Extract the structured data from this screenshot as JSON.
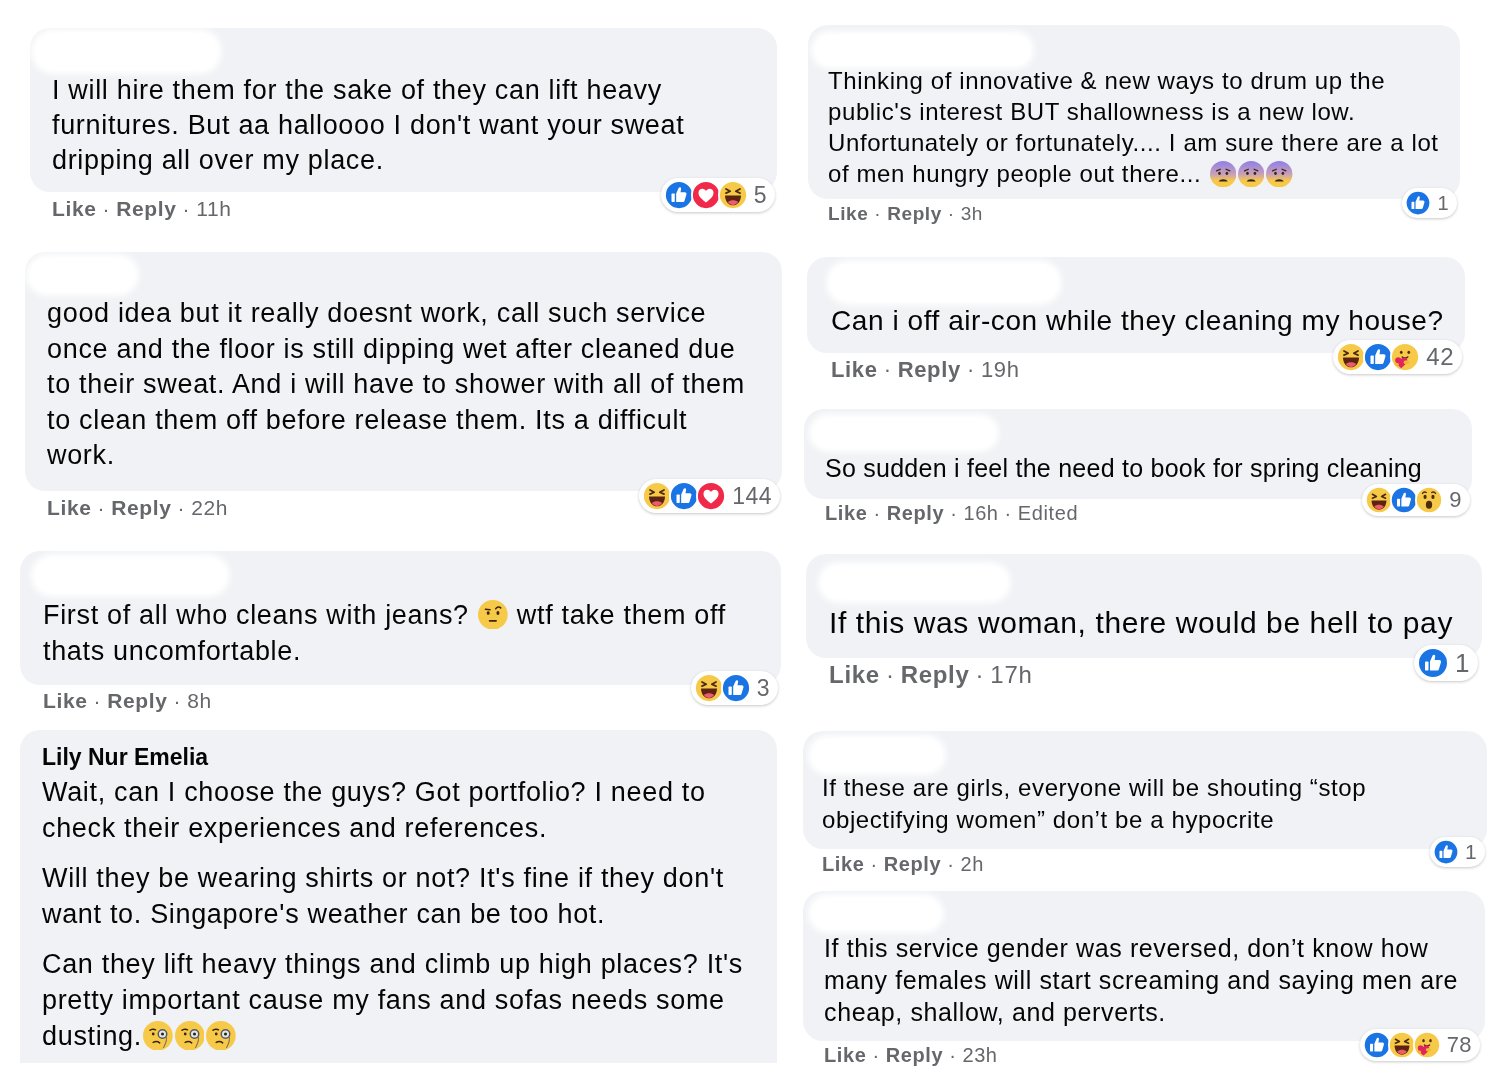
{
  "columns": [
    {
      "comments": [
        {
          "author_hidden": true,
          "body": [
            {
              "rows": [
                [
                  {
                    "kind": "text",
                    "text": "I will hire them for the sake of they can lift heavy furnitures. But aa halloooo I don't want your sweat dripping all over my place."
                  }
                ]
              ]
            }
          ],
          "meta": [
            {
              "kind": "action",
              "text": "Like"
            },
            {
              "kind": "separator",
              "text": "·"
            },
            {
              "kind": "action",
              "text": "Reply"
            },
            {
              "kind": "separator",
              "text": "·"
            },
            {
              "kind": "time",
              "text": "11h"
            }
          ],
          "reactions": {
            "icons": [
              {
                "kind": "like"
              },
              {
                "kind": "love"
              },
              {
                "kind": "haha"
              }
            ],
            "count": "5"
          }
        },
        {
          "author_hidden": true,
          "body": [
            {
              "rows": [
                [
                  {
                    "kind": "text",
                    "text": "good idea but it really doesnt work, call such service once and the floor is still dipping wet after cleaned due to their sweat. And i will have to shower with all of them to clean them off before release them. Its a difficult work."
                  }
                ]
              ]
            }
          ],
          "meta": [
            {
              "kind": "action",
              "text": "Like"
            },
            {
              "kind": "separator",
              "text": "·"
            },
            {
              "kind": "action",
              "text": "Reply"
            },
            {
              "kind": "separator",
              "text": "·"
            },
            {
              "kind": "time",
              "text": "22h"
            }
          ],
          "reactions": {
            "icons": [
              {
                "kind": "haha"
              },
              {
                "kind": "like"
              },
              {
                "kind": "love"
              }
            ],
            "count": "144"
          }
        },
        {
          "author_hidden": true,
          "body": [
            {
              "rows": [
                [
                  {
                    "kind": "text",
                    "text": "First of all who cleans with jeans? "
                  },
                  {
                    "kind": "raised_eyebrow"
                  },
                  {
                    "kind": "text",
                    "text": " wtf take them off"
                  }
                ],
                [
                  {
                    "kind": "text",
                    "text": "thats uncomfortable."
                  }
                ]
              ]
            }
          ],
          "meta": [
            {
              "kind": "action",
              "text": "Like"
            },
            {
              "kind": "separator",
              "text": "·"
            },
            {
              "kind": "action",
              "text": "Reply"
            },
            {
              "kind": "separator",
              "text": "·"
            },
            {
              "kind": "time",
              "text": "8h"
            }
          ],
          "reactions": {
            "icons": [
              {
                "kind": "haha"
              },
              {
                "kind": "like"
              }
            ],
            "count": "3"
          }
        },
        {
          "author_hidden": false,
          "author": "Lily Nur Emelia",
          "body": [
            {
              "rows": [
                [
                  {
                    "kind": "text",
                    "text": "Wait, can I choose the guys? Got portfolio? I need to check their experiences and references."
                  }
                ]
              ]
            },
            {
              "rows": [
                [
                  {
                    "kind": "text",
                    "text": "Will they be wearing shirts or not? It's fine if they don't want to. Singapore's weather can be too hot."
                  }
                ]
              ]
            },
            {
              "rows": [
                [
                  {
                    "kind": "text",
                    "text": "Can they lift heavy things and climb up high places? It's pretty important cause my fans and sofas needs some"
                  }
                ],
                [
                  {
                    "kind": "text",
                    "text": "dusting."
                  },
                  {
                    "kind": "monocle"
                  },
                  {
                    "kind": "monocle"
                  },
                  {
                    "kind": "monocle"
                  }
                ]
              ]
            }
          ]
        }
      ]
    },
    {
      "comments": [
        {
          "author_hidden": true,
          "body": [
            {
              "rows": [
                [
                  {
                    "kind": "text",
                    "text": "Thinking of innovative & new ways to drum up the public's interest BUT shallowness is a new low. Unfortunately or fortunately.... I am sure there are a lot"
                  }
                ],
                [
                  {
                    "kind": "text",
                    "text": "of men hungry people out there... "
                  },
                  {
                    "kind": "worried"
                  },
                  {
                    "kind": "worried"
                  },
                  {
                    "kind": "worried"
                  }
                ]
              ]
            }
          ],
          "meta": [
            {
              "kind": "action",
              "text": "Like"
            },
            {
              "kind": "separator",
              "text": "·"
            },
            {
              "kind": "action",
              "text": "Reply"
            },
            {
              "kind": "separator",
              "text": "·"
            },
            {
              "kind": "time",
              "text": "3h"
            }
          ],
          "reactions": {
            "icons": [
              {
                "kind": "like"
              }
            ],
            "count": "1"
          }
        },
        {
          "author_hidden": true,
          "body": [
            {
              "rows": [
                [
                  {
                    "kind": "text",
                    "text": "Can i off air-con while they cleaning my house?"
                  }
                ]
              ]
            }
          ],
          "meta": [
            {
              "kind": "action",
              "text": "Like"
            },
            {
              "kind": "separator",
              "text": "·"
            },
            {
              "kind": "action",
              "text": "Reply"
            },
            {
              "kind": "separator",
              "text": "·"
            },
            {
              "kind": "time",
              "text": "19h"
            }
          ],
          "reactions": {
            "icons": [
              {
                "kind": "haha"
              },
              {
                "kind": "like"
              },
              {
                "kind": "care"
              }
            ],
            "count": "42"
          }
        },
        {
          "author_hidden": true,
          "body": [
            {
              "rows": [
                [
                  {
                    "kind": "text",
                    "text": "So sudden i feel the need to book for spring cleaning"
                  }
                ]
              ]
            }
          ],
          "meta": [
            {
              "kind": "action",
              "text": "Like"
            },
            {
              "kind": "separator",
              "text": "·"
            },
            {
              "kind": "action",
              "text": "Reply"
            },
            {
              "kind": "separator",
              "text": "·"
            },
            {
              "kind": "time",
              "text": "16h"
            },
            {
              "kind": "separator",
              "text": "·"
            },
            {
              "kind": "time",
              "text": "Edited"
            }
          ],
          "reactions": {
            "icons": [
              {
                "kind": "haha"
              },
              {
                "kind": "like"
              },
              {
                "kind": "wow"
              }
            ],
            "count": "9"
          }
        },
        {
          "author_hidden": true,
          "body": [
            {
              "rows": [
                [
                  {
                    "kind": "text",
                    "text": "If this was woman, there would be hell to pay"
                  }
                ]
              ]
            }
          ],
          "meta": [
            {
              "kind": "action",
              "text": "Like"
            },
            {
              "kind": "separator",
              "text": "·"
            },
            {
              "kind": "action",
              "text": "Reply"
            },
            {
              "kind": "separator",
              "text": "·"
            },
            {
              "kind": "time",
              "text": "17h"
            }
          ],
          "reactions": {
            "icons": [
              {
                "kind": "like"
              }
            ],
            "count": "1"
          }
        },
        {
          "author_hidden": true,
          "body": [
            {
              "rows": [
                [
                  {
                    "kind": "text",
                    "text": "If these are girls, everyone will be shouting “stop objectifying women” don’t be a hypocrite"
                  }
                ]
              ]
            }
          ],
          "meta": [
            {
              "kind": "action",
              "text": "Like"
            },
            {
              "kind": "separator",
              "text": "·"
            },
            {
              "kind": "action",
              "text": "Reply"
            },
            {
              "kind": "separator",
              "text": "·"
            },
            {
              "kind": "time",
              "text": "2h"
            }
          ],
          "reactions": {
            "icons": [
              {
                "kind": "like"
              }
            ],
            "count": "1"
          }
        },
        {
          "author_hidden": true,
          "body": [
            {
              "rows": [
                [
                  {
                    "kind": "text",
                    "text": "If this service gender was reversed, don’t know how many females will start screaming and saying men are cheap, shallow, and perverts."
                  }
                ]
              ]
            }
          ],
          "meta": [
            {
              "kind": "action",
              "text": "Like"
            },
            {
              "kind": "separator",
              "text": "·"
            },
            {
              "kind": "action",
              "text": "Reply"
            },
            {
              "kind": "separator",
              "text": "·"
            },
            {
              "kind": "time",
              "text": "23h"
            }
          ],
          "reactions": {
            "icons": [
              {
                "kind": "like"
              },
              {
                "kind": "haha"
              },
              {
                "kind": "care"
              }
            ],
            "count": "78"
          }
        }
      ]
    }
  ]
}
